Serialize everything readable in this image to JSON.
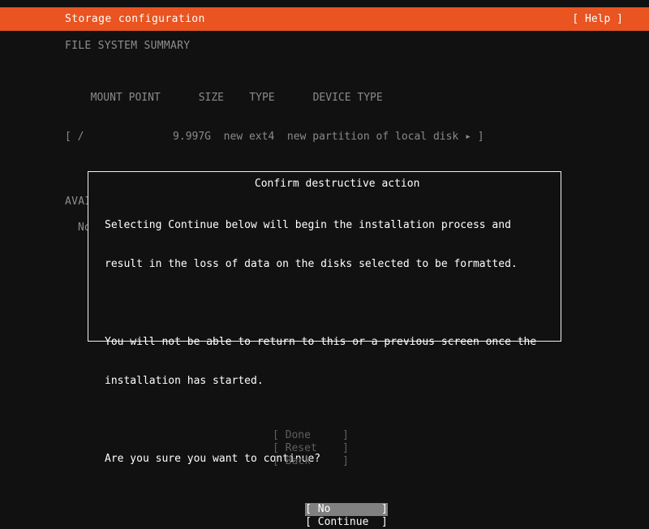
{
  "header": {
    "title": "Storage configuration",
    "help_label": "[ Help ]",
    "bar_color": "#e95420",
    "text_color": "#ffffff"
  },
  "main": {
    "filesystem_section_title": "FILE SYSTEM SUMMARY",
    "filesystem_table": {
      "headers_line": "  MOUNT POINT      SIZE    TYPE      DEVICE TYPE",
      "columns": [
        "MOUNT POINT",
        "SIZE",
        "TYPE",
        "DEVICE TYPE"
      ],
      "rows": [
        {
          "line": "[ /              9.997G  new ext4  new partition of local disk ▸ ]",
          "mount_point": "/",
          "size": "9.997G",
          "type": "new ext4",
          "device_type": "new partition of local disk",
          "expander_icon": "▸"
        }
      ]
    },
    "available_devices_title": "AVAILABLE DEVICES",
    "available_devices_empty": "No available devices"
  },
  "dialog": {
    "title": "Confirm destructive action",
    "paragraph1": [
      "Selecting Continue below will begin the installation process and",
      "result in the loss of data on the disks selected to be formatted."
    ],
    "paragraph2": [
      "You will not be able to return to this or a previous screen once the",
      "installation has started."
    ],
    "question": "Are you sure you want to continue?",
    "buttons": [
      {
        "label": "[ No        ]",
        "selected": true
      },
      {
        "label": "[ Continue  ]",
        "selected": false
      }
    ],
    "highlight_color": "#808080",
    "border_color": "#f2f2f2"
  },
  "footer": {
    "buttons": [
      {
        "label": "[ Done     ]"
      },
      {
        "label": "[ Reset    ]"
      },
      {
        "label": "[ Back     ]"
      }
    ],
    "disabled_color": "#5f5f5f"
  }
}
